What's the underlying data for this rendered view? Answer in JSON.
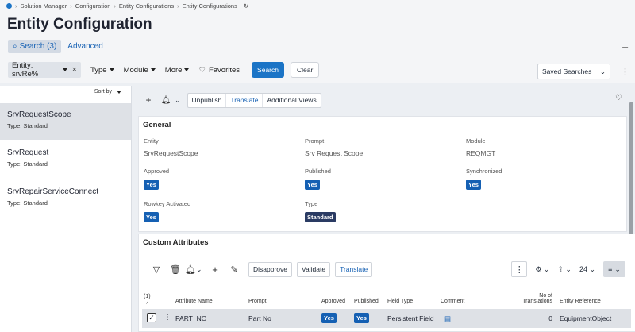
{
  "breadcrumb": [
    "Solution Manager",
    "Configuration",
    "Entity Configurations",
    "Entity Configurations"
  ],
  "page_title": "Entity Configuration",
  "tabs": {
    "search": "Search (3)",
    "advanced": "Advanced"
  },
  "filters": {
    "entity_chip": "Entity: srvRe%",
    "type": "Type",
    "module": "Module",
    "more": "More",
    "favorites": "Favorites",
    "search_btn": "Search",
    "clear_btn": "Clear"
  },
  "saved_searches": "Saved Searches",
  "left_panel": {
    "sort_by": "Sort by",
    "items": [
      {
        "name": "SrvRequestScope",
        "type": "Type:  Standard"
      },
      {
        "name": "SrvRequest",
        "type": "Type:  Standard"
      },
      {
        "name": "SrvRepairServiceConnect",
        "type": "Type:  Standard"
      }
    ]
  },
  "toolbar": {
    "unpublish": "Unpublish",
    "translate": "Translate",
    "additional_views": "Additional Views"
  },
  "general": {
    "title": "General",
    "entity_label": "Entity",
    "entity_value": "SrvRequestScope",
    "prompt_label": "Prompt",
    "prompt_value": "Srv Request Scope",
    "module_label": "Module",
    "module_value": "REQMGT",
    "approved_label": "Approved",
    "approved_value": "Yes",
    "published_label": "Published",
    "published_value": "Yes",
    "synchronized_label": "Synchronized",
    "synchronized_value": "Yes",
    "rowkey_label": "Rowkey Activated",
    "rowkey_value": "Yes",
    "type_label": "Type",
    "type_value": "Standard"
  },
  "custom_attributes": {
    "title": "Custom Attributes",
    "disapprove": "Disapprove",
    "validate": "Validate",
    "translate": "Translate",
    "page_size": "24",
    "selected_count": "(1)",
    "columns": {
      "attribute_name": "Attribute Name",
      "prompt": "Prompt",
      "approved": "Approved",
      "published": "Published",
      "field_type": "Field Type",
      "comment": "Comment",
      "translations_1": "No of",
      "translations_2": "Translations",
      "entity_reference": "Entity Reference"
    },
    "row": {
      "attribute_name": "PART_NO",
      "prompt": "Part No",
      "approved": "Yes",
      "published": "Yes",
      "field_type": "Persistent Field",
      "translations": "0",
      "entity_reference": "EquipmentObject"
    }
  },
  "colors": {
    "accent": "#1b74c6",
    "badge": "#1560b3",
    "badge_dark": "#2a3b63",
    "selected_row": "#dee1e6"
  }
}
